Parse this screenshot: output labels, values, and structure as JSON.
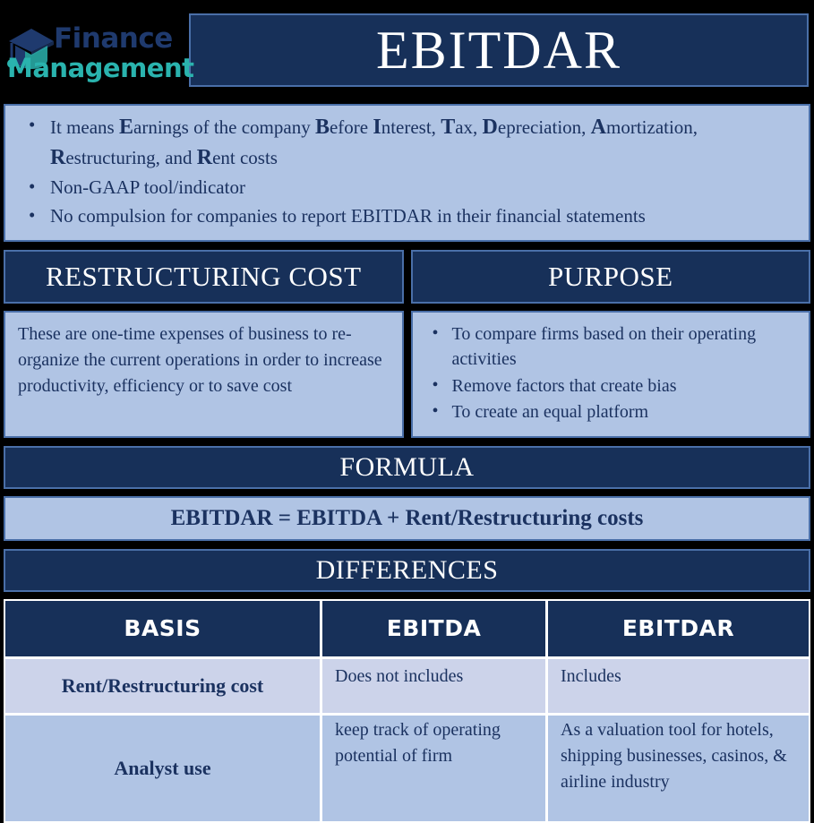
{
  "colors": {
    "navy": "#173059",
    "light_blue": "#b0c4e4",
    "row_alt": "#ccd3ea",
    "border_blue": "#4a6fa8",
    "teal": "#2ab3ae",
    "logo_navy": "#1f3a6e",
    "background": "#000000",
    "white": "#ffffff"
  },
  "header": {
    "logo": {
      "icon": "graduation-cap-icon",
      "word1": "Finance",
      "word2": "Management"
    },
    "title": "EBITDAR"
  },
  "intro": {
    "bullets": [
      {
        "parts": [
          {
            "t": "It means ",
            "cap": false
          },
          {
            "t": "E",
            "cap": true
          },
          {
            "t": "arnings of the company ",
            "cap": false
          },
          {
            "t": "B",
            "cap": true
          },
          {
            "t": "efore ",
            "cap": false
          },
          {
            "t": "I",
            "cap": true
          },
          {
            "t": "nterest, ",
            "cap": false
          },
          {
            "t": "T",
            "cap": true
          },
          {
            "t": "ax, ",
            "cap": false
          },
          {
            "t": "D",
            "cap": true
          },
          {
            "t": "epreciation, ",
            "cap": false
          },
          {
            "t": "A",
            "cap": true
          },
          {
            "t": "mortization, ",
            "cap": false
          },
          {
            "t": "R",
            "cap": true
          },
          {
            "t": "estructuring, and ",
            "cap": false
          },
          {
            "t": "R",
            "cap": true
          },
          {
            "t": "ent costs",
            "cap": false
          }
        ]
      },
      {
        "parts": [
          {
            "t": "Non-GAAP tool/indicator",
            "cap": false
          }
        ]
      },
      {
        "parts": [
          {
            "t": "No compulsion for companies to report EBITDAR in their financial statements",
            "cap": false
          }
        ]
      }
    ]
  },
  "columns": [
    {
      "heading": "RESTRUCTURING COST",
      "paragraph": "These are one-time expenses of business to re-organize the current operations in order to increase productivity, efficiency or to save cost",
      "bullets": []
    },
    {
      "heading": "PURPOSE",
      "paragraph": "",
      "bullets": [
        "To compare firms based on their operating activities",
        "Remove factors that create bias",
        "To create an equal platform"
      ]
    }
  ],
  "formula": {
    "heading": "FORMULA",
    "expression": "EBITDAR = EBITDA + Rent/Restructuring costs"
  },
  "differences": {
    "heading": "DIFFERENCES",
    "table": {
      "headers": [
        "BASIS",
        "EBITDA",
        "EBITDAR"
      ],
      "rows": [
        {
          "basis": "Rent/Restructuring cost",
          "ebitda": "Does not includes",
          "ebitdar": "Includes"
        },
        {
          "basis": "Analyst use",
          "ebitda": "keep track of operating potential of firm",
          "ebitdar": "As a valuation tool for hotels, shipping businesses, casinos, & airline industry"
        }
      ]
    }
  }
}
